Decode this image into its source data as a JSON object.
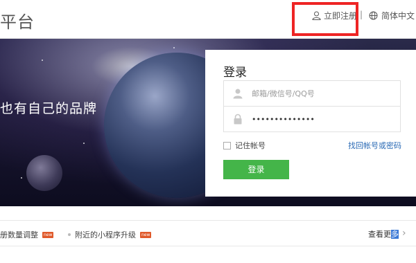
{
  "header": {
    "brand": "平台",
    "register_label": "立即注册",
    "separator": "|",
    "language_label": "简体中文"
  },
  "banner": {
    "slogan": "也有自己的品牌"
  },
  "login": {
    "title": "登录",
    "username_placeholder": "邮箱/微信号/QQ号",
    "password_value": "••••••••••••••",
    "remember_label": "记住帐号",
    "forgot_label": "找回帐号或密码",
    "submit_label": "登录"
  },
  "notices": {
    "items": [
      {
        "label": "册数量调整",
        "badge": "new"
      },
      {
        "label": "附近的小程序升级",
        "badge": "new"
      }
    ],
    "more_prefix": "查看更",
    "more_selected": "多",
    "more_arrow": "›"
  },
  "colors": {
    "accent_green": "#44b549",
    "link_blue": "#2a6ab5",
    "highlight_red": "#ee2424",
    "badge_orange": "#e0592a"
  }
}
